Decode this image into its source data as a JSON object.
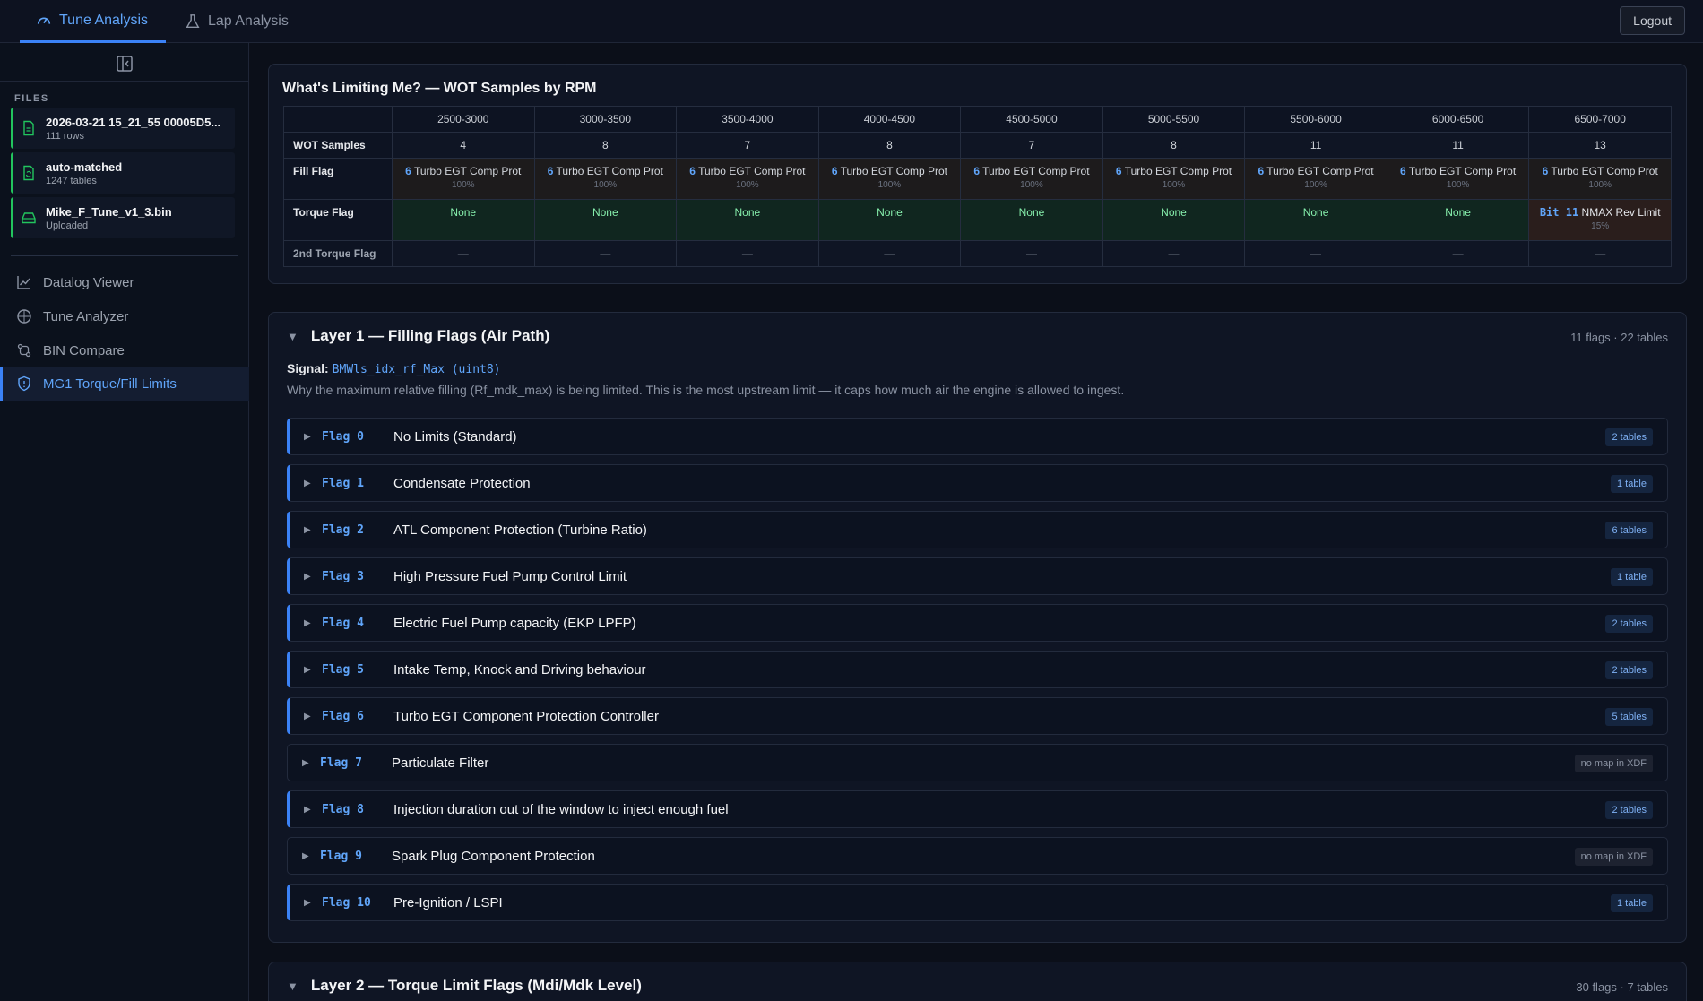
{
  "tabs": [
    {
      "label": "Tune Analysis",
      "active": true
    },
    {
      "label": "Lap Analysis",
      "active": false
    }
  ],
  "logout_label": "Logout",
  "sidebar": {
    "files_label": "FILES",
    "files": [
      {
        "name": "2026-03-21 15_21_55 00005D5...",
        "sub": "111 rows"
      },
      {
        "name": "auto-matched",
        "sub": "1247 tables"
      },
      {
        "name": "Mike_F_Tune_v1_3.bin",
        "sub": "Uploaded"
      }
    ],
    "nav": [
      {
        "label": "Datalog Viewer",
        "icon": "chart-line-icon",
        "active": false
      },
      {
        "label": "Tune Analyzer",
        "icon": "compass-icon",
        "active": false
      },
      {
        "label": "BIN Compare",
        "icon": "compare-icon",
        "active": false
      },
      {
        "label": "MG1 Torque/Fill Limits",
        "icon": "shield-icon",
        "active": true
      }
    ]
  },
  "wot": {
    "title": "What's Limiting Me? — WOT Samples by RPM",
    "rpm_bins": [
      "2500-3000",
      "3000-3500",
      "3500-4000",
      "4000-4500",
      "4500-5000",
      "5000-5500",
      "5500-6000",
      "6000-6500",
      "6500-7000"
    ],
    "row_labels": {
      "samples": "WOT Samples",
      "fill": "Fill Flag",
      "torque": "Torque Flag",
      "second": "2nd Torque Flag"
    },
    "samples": [
      "4",
      "8",
      "7",
      "8",
      "7",
      "8",
      "11",
      "11",
      "13"
    ],
    "fill": [
      {
        "num": "6",
        "label": "Turbo EGT Comp Prot",
        "pct": "100%"
      },
      {
        "num": "6",
        "label": "Turbo EGT Comp Prot",
        "pct": "100%"
      },
      {
        "num": "6",
        "label": "Turbo EGT Comp Prot",
        "pct": "100%"
      },
      {
        "num": "6",
        "label": "Turbo EGT Comp Prot",
        "pct": "100%"
      },
      {
        "num": "6",
        "label": "Turbo EGT Comp Prot",
        "pct": "100%"
      },
      {
        "num": "6",
        "label": "Turbo EGT Comp Prot",
        "pct": "100%"
      },
      {
        "num": "6",
        "label": "Turbo EGT Comp Prot",
        "pct": "100%"
      },
      {
        "num": "6",
        "label": "Turbo EGT Comp Prot",
        "pct": "100%"
      },
      {
        "num": "6",
        "label": "Turbo EGT Comp Prot",
        "pct": "100%"
      }
    ],
    "torque": [
      {
        "label": "None"
      },
      {
        "label": "None"
      },
      {
        "label": "None"
      },
      {
        "label": "None"
      },
      {
        "label": "None"
      },
      {
        "label": "None"
      },
      {
        "label": "None"
      },
      {
        "label": "None"
      },
      {
        "bit": "Bit 11",
        "label": "NMAX Rev Limit",
        "pct": "15%"
      }
    ],
    "second": [
      "—",
      "—",
      "—",
      "—",
      "—",
      "—",
      "—",
      "—",
      "—"
    ]
  },
  "layer1": {
    "title": "Layer 1 — Filling Flags (Air Path)",
    "meta": "11 flags · 22 tables",
    "signal_label": "Signal:",
    "signal_name": "BMWls_idx_rf_Max (uint8)",
    "description": "Why the maximum relative filling (Rf_mdk_max) is being limited. This is the most upstream limit — it caps how much air the engine is allowed to ingest.",
    "flags": [
      {
        "id": "Flag 0",
        "desc": "No Limits (Standard)",
        "badge": "2 tables",
        "mapped": true
      },
      {
        "id": "Flag 1",
        "desc": "Condensate Protection",
        "badge": "1 table",
        "mapped": true
      },
      {
        "id": "Flag 2",
        "desc": "ATL Component Protection (Turbine Ratio)",
        "badge": "6 tables",
        "mapped": true
      },
      {
        "id": "Flag 3",
        "desc": "High Pressure Fuel Pump Control Limit",
        "badge": "1 table",
        "mapped": true
      },
      {
        "id": "Flag 4",
        "desc": "Electric Fuel Pump capacity (EKP LPFP)",
        "badge": "2 tables",
        "mapped": true
      },
      {
        "id": "Flag 5",
        "desc": "Intake Temp, Knock and Driving behaviour",
        "badge": "2 tables",
        "mapped": true
      },
      {
        "id": "Flag 6",
        "desc": "Turbo EGT Component Protection Controller",
        "badge": "5 tables",
        "mapped": true
      },
      {
        "id": "Flag 7",
        "desc": "Particulate Filter",
        "badge": "no map in XDF",
        "mapped": false
      },
      {
        "id": "Flag 8",
        "desc": "Injection duration out of the window to inject enough fuel",
        "badge": "2 tables",
        "mapped": true
      },
      {
        "id": "Flag 9",
        "desc": "Spark Plug Component Protection",
        "badge": "no map in XDF",
        "mapped": false
      },
      {
        "id": "Flag 10",
        "desc": "Pre-Ignition / LSPI",
        "badge": "1 table",
        "mapped": true
      }
    ]
  },
  "layer2": {
    "title": "Layer 2 — Torque Limit Flags (Mdi/Mdk Level)",
    "meta": "30 flags · 7 tables"
  }
}
